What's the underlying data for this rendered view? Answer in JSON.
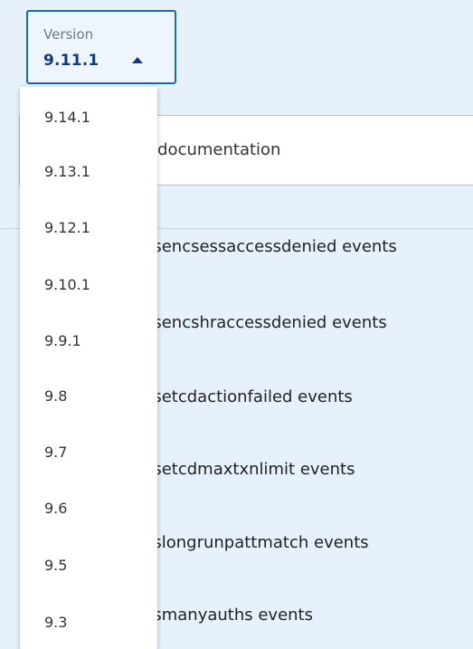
{
  "version_selector": {
    "label": "Version",
    "current": "9.11.1",
    "icon": "caret-up-icon",
    "options": [
      "9.14.1",
      "9.13.1",
      "9.12.1",
      "9.10.1",
      "9.9.1",
      "9.8",
      "9.7",
      "9.6",
      "9.5",
      "9.3"
    ]
  },
  "search": {
    "placeholder_visible": "n documentation"
  },
  "results": [
    "ifsencsessaccessdenied events",
    "ifsencshraccessdenied events",
    "ifsetcdactionfailed events",
    "ifsetcdmaxtxnlimit events",
    "ifslongrunpattmatch events",
    "ifsmanyauths events"
  ],
  "colors": {
    "accent": "#1766c9",
    "page_background": "#e6f1fb",
    "version_text": "#0f3b82"
  }
}
